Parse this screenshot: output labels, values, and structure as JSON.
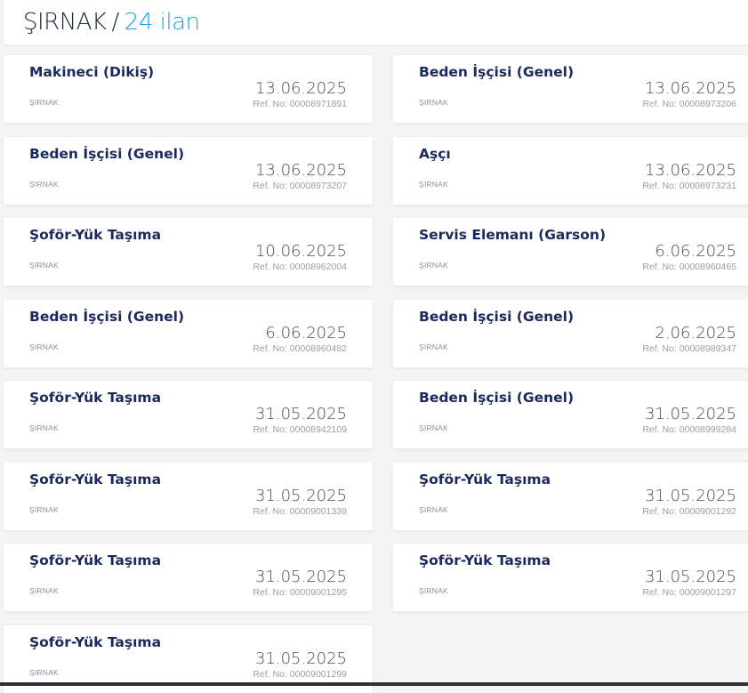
{
  "header": {
    "city": "ŞIRNAK",
    "separator": "/",
    "count": "24 ilan"
  },
  "colors": {
    "title": "#1b2a5c",
    "accent": "#1aa3e8",
    "background": "#f4f4f5"
  },
  "listings": [
    {
      "title": "Makineci (Dikiş)",
      "city": "ŞIRNAK",
      "date": "13.06.2025",
      "ref": "Ref. No: 00008971891"
    },
    {
      "title": "Beden İşçisi (Genel)",
      "city": "ŞIRNAK",
      "date": "13.06.2025",
      "ref": "Ref. No: 00008973206"
    },
    {
      "title": "Beden İşçisi (Genel)",
      "city": "ŞIRNAK",
      "date": "13.06.2025",
      "ref": "Ref. No: 00008973207"
    },
    {
      "title": "Aşçı",
      "city": "ŞIRNAK",
      "date": "13.06.2025",
      "ref": "Ref. No: 00008973231"
    },
    {
      "title": "Şoför-Yük Taşıma",
      "city": "ŞIRNAK",
      "date": "10.06.2025",
      "ref": "Ref. No: 00008962004"
    },
    {
      "title": "Servis Elemanı (Garson)",
      "city": "ŞIRNAK",
      "date": "6.06.2025",
      "ref": "Ref. No: 00008960465"
    },
    {
      "title": "Beden İşçisi (Genel)",
      "city": "ŞIRNAK",
      "date": "6.06.2025",
      "ref": "Ref. No: 00008960482"
    },
    {
      "title": "Beden İşçisi (Genel)",
      "city": "ŞIRNAK",
      "date": "2.06.2025",
      "ref": "Ref. No: 00008989347"
    },
    {
      "title": "Şoför-Yük Taşıma",
      "city": "ŞIRNAK",
      "date": "31.05.2025",
      "ref": "Ref. No: 00008942109"
    },
    {
      "title": "Beden İşçisi (Genel)",
      "city": "ŞIRNAK",
      "date": "31.05.2025",
      "ref": "Ref. No: 00008999284"
    },
    {
      "title": "Şoför-Yük Taşıma",
      "city": "ŞIRNAK",
      "date": "31.05.2025",
      "ref": "Ref. No: 00009001339"
    },
    {
      "title": "Şoför-Yük Taşıma",
      "city": "ŞIRNAK",
      "date": "31.05.2025",
      "ref": "Ref. No: 00009001292"
    },
    {
      "title": "Şoför-Yük Taşıma",
      "city": "ŞIRNAK",
      "date": "31.05.2025",
      "ref": "Ref. No: 00009001295"
    },
    {
      "title": "Şoför-Yük Taşıma",
      "city": "ŞIRNAK",
      "date": "31.05.2025",
      "ref": "Ref. No: 00009001297"
    },
    {
      "title": "Şoför-Yük Taşıma",
      "city": "ŞIRNAK",
      "date": "31.05.2025",
      "ref": "Ref. No: 00009001299"
    }
  ]
}
